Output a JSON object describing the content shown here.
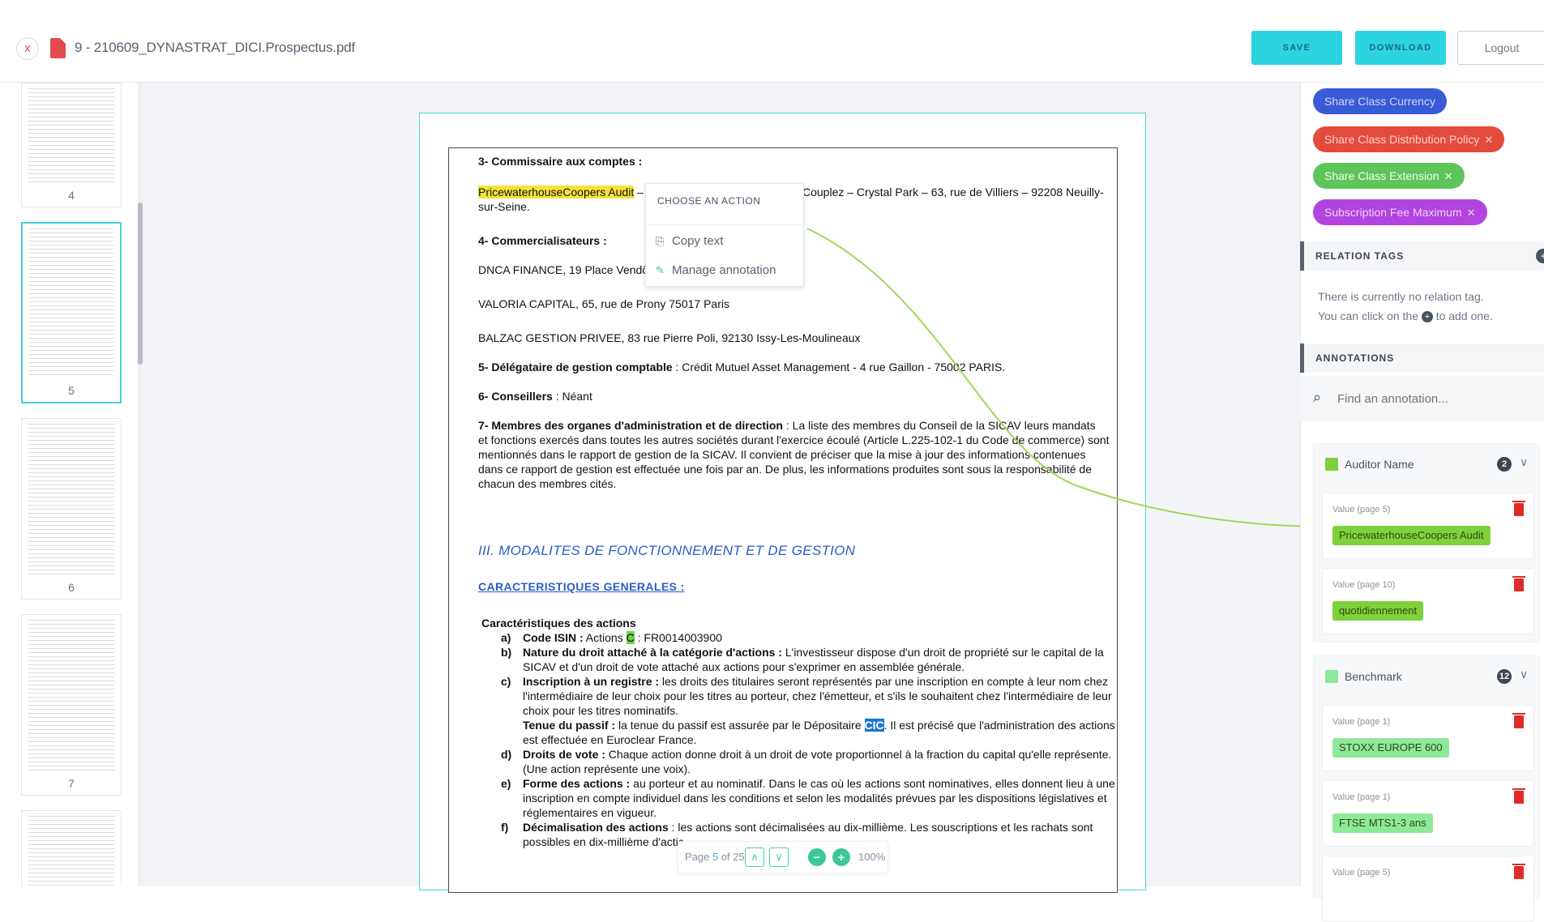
{
  "header": {
    "close_icon": "x",
    "file_name": "9 - 210609_DYNASTRAT_DICI.Prospectus.pdf",
    "save_label": "SAVE",
    "download_label": "DOWNLOAD",
    "logout_label": "Logout"
  },
  "thumbnails": [
    {
      "num": "4"
    },
    {
      "num": "5",
      "active": true
    },
    {
      "num": "6"
    },
    {
      "num": "7"
    }
  ],
  "document": {
    "l1": "3- Commissaire aux comptes :",
    "l2_hl": "PricewaterhouseCoopers Audit",
    "l2_dash": " – ",
    "l2_rest": "Couplez – Crystal Park – 63, rue de Villiers – 92208 Neuilly-",
    "l3": "sur-Seine.",
    "l4": "4- Commercialisateurs :",
    "l5": "DNCA FINANCE, 19 Place Vendô",
    "l6": "VALORIA CAPITAL, 65, rue de Prony 75017 Paris",
    "l7": "BALZAC GESTION PRIVEE, 83 rue Pierre Poli, 92130 Issy-Les-Moulineaux",
    "l8_b": "5- Délégataire de gestion comptable",
    "l8_r": " : Crédit Mutuel Asset Management - 4 rue Gaillon - 75002 PARIS.",
    "l9_b": "6- Conseillers",
    "l9_r": " : Néant",
    "l10_b": "7- Membres des organes d'administration et de direction",
    "l10_r": " : La liste des membres du Conseil de la SICAV leurs mandats",
    "l11": "et fonctions exercés dans toutes les autres sociétés durant l'exercice écoulé (Article L.225-102-1 du Code de commerce) sont",
    "l12": "mentionnés dans le rapport de gestion de la SICAV. Il convient de préciser que la mise à jour des informations contenues",
    "l13": "dans ce rapport de gestion est effectuée une fois par an. De plus, les informations produites sont sous la responsabilité de",
    "l14": "chacun des membres cités.",
    "section_title": "III. MODALITES DE FONCTIONNEMENT ET DE GESTION",
    "section_sub": "CARACTERISTIQUES GENERALES :",
    "c0": "Caractéristiques des actions",
    "ca_l": "a)",
    "ca_b": "Code ISIN :",
    "ca_r1": " Actions ",
    "ca_hl": "C",
    "ca_r2": " : FR0014003900",
    "cb_l": "b)",
    "cb_b": "Nature du droit attaché à la catégorie d'actions :",
    "cb_r": " L'investisseur dispose d'un droit de propriété sur le capital de la",
    "cb2": "SICAV et d'un droit de vote attaché aux actions pour s'exprimer en assemblée générale.",
    "cc_l": "c)",
    "cc_b": "Inscription à un registre :",
    "cc_r": " les droits des titulaires seront représentés par une inscription en compte à leur nom chez",
    "cc2": "l'intermédiaire de leur choix pour les titres au porteur, chez l'émetteur, et s'ils le souhaitent chez l'intermédiaire de leur",
    "cc3": "choix pour les titres nominatifs.",
    "cc4_b": "Tenue du passif :",
    "cc4_r": " la tenue du passif est assurée par le Dépositaire ",
    "cc4_hl": "CIC",
    "cc4_r2": ". Il est précisé que l'administration des actions",
    "cc5": "est effectuée en Euroclear France.",
    "cd_l": "d)",
    "cd_b": "Droits de vote :",
    "cd_r": " Chaque action donne droit à un droit de vote proportionnel à la fraction du capital qu'elle représente.",
    "cd2": "(Une action représente une voix).",
    "ce_l": "e)",
    "ce_b": "Forme des actions :",
    "ce_r": " au porteur et au nominatif. Dans le cas où les actions sont nominatives, elles donnent lieu à une",
    "ce2": "inscription en compte individuel dans les conditions et selon les modalités prévues par les dispositions législatives et",
    "ce3": "réglementaires en vigueur.",
    "cf_l": "f)",
    "cf_b": "Décimalisation des actions",
    "cf_r": " : les actions sont décimalisées au dix-millième. Les souscriptions et les rachats sont",
    "cf2": "possibles en dix-millième d'actic"
  },
  "context_menu": {
    "title": "CHOOSE AN ACTION",
    "copy": "Copy text",
    "manage": "Manage annotation"
  },
  "page_nav": {
    "prefix": "Page ",
    "current": "5",
    "suffix": " of 25",
    "zoom": "100%"
  },
  "right_panel": {
    "tags": [
      {
        "label": "Share Class Currency",
        "color": "#3a5bd6"
      },
      {
        "label": "Share Class Distribution Policy",
        "color": "#e54b3c"
      },
      {
        "label": "Share Class Extension",
        "color": "#5dc55a"
      },
      {
        "label": "Subscription Fee Maximum",
        "color": "#b344e0"
      }
    ],
    "relation_tags_title": "RELATION TAGS",
    "relation_msg_1": "There is currently no relation tag.",
    "relation_msg_2a": "You can click on the",
    "relation_msg_2b": "to add one.",
    "annotations_title": "ANNOTATIONS",
    "search_placeholder": "Find an annotation...",
    "groups": [
      {
        "name": "Auditor Name",
        "count": "2",
        "swatch": "#7fd13b",
        "items": [
          {
            "label": "Value (page 5)",
            "value": "PricewaterhouseCoopers Audit",
            "color": "#7fd13b"
          },
          {
            "label": "Value (page 10)",
            "value": "quotidiennement",
            "color": "#7fd13b"
          }
        ]
      },
      {
        "name": "Benchmark",
        "count": "12",
        "swatch": "#8ee89a",
        "items": [
          {
            "label": "Value (page 1)",
            "value": "STOXX EUROPE 600",
            "color": "#8ee89a"
          },
          {
            "label": "Value (page 1)",
            "value": "FTSE MTS1-3 ans",
            "color": "#8ee89a"
          },
          {
            "label": "Value (page 5)",
            "value": "",
            "color": "#8ee89a"
          }
        ]
      }
    ]
  }
}
